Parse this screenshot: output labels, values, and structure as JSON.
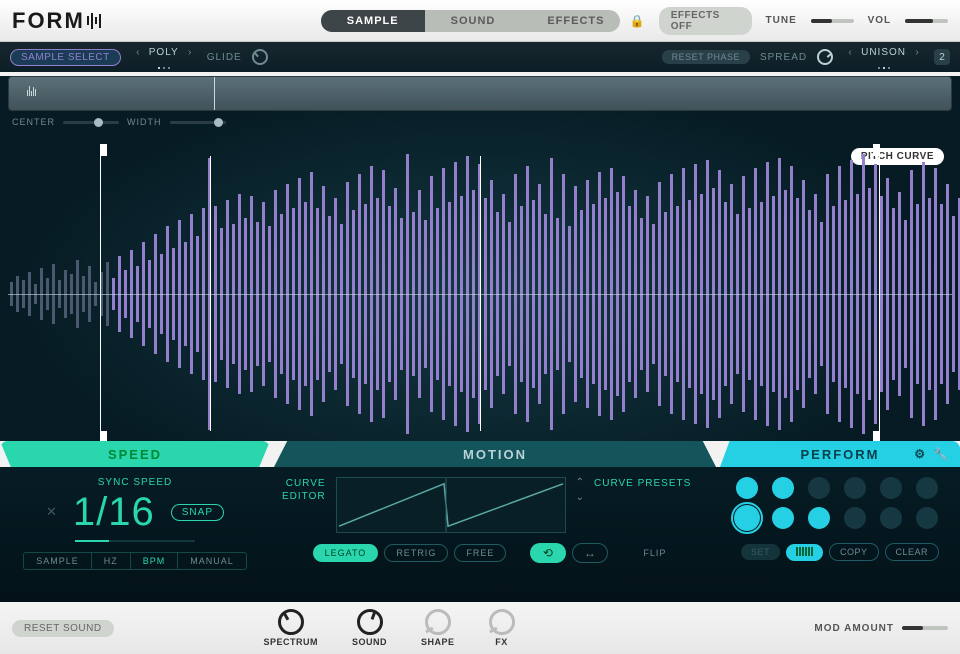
{
  "app": {
    "name": "FORM"
  },
  "top": {
    "tabs": [
      "SAMPLE",
      "SOUND",
      "EFFECTS"
    ],
    "active_tab": "SAMPLE",
    "effects_toggle": "EFFECTS OFF",
    "tune_label": "TUNE",
    "vol_label": "VOL"
  },
  "sub": {
    "sample_select": "SAMPLE SELECT",
    "voice_mode": "POLY",
    "glide": "GLIDE",
    "reset_phase": "RESET PHASE",
    "spread": "SPREAD",
    "unison": "UNISON",
    "unison_count": "2"
  },
  "wave": {
    "center": "CENTER",
    "width": "WIDTH",
    "pitch_curve": "PITCH CURVE"
  },
  "sections": {
    "speed": "SPEED",
    "motion": "MOTION",
    "perform": "PERFORM"
  },
  "speed": {
    "title": "SYNC SPEED",
    "value": "1/16",
    "snap": "SNAP",
    "modes": [
      "SAMPLE",
      "HZ",
      "BPM",
      "MANUAL"
    ],
    "active_mode": "BPM"
  },
  "motion": {
    "curve_editor": "CURVE\nEDITOR",
    "curve_presets": "CURVE\nPRESETS",
    "legato": "LEGATO",
    "retrig": "RETRIG",
    "free": "FREE",
    "flip": "FLIP"
  },
  "perform": {
    "set": "SET",
    "copy": "COPY",
    "clear": "CLEAR",
    "slots": [
      {
        "on": true
      },
      {
        "on": true
      },
      {
        "on": false
      },
      {
        "on": false
      },
      {
        "on": false
      },
      {
        "on": false
      },
      {
        "on": true,
        "sel": true
      },
      {
        "on": true
      },
      {
        "on": true
      },
      {
        "on": false
      },
      {
        "on": false
      },
      {
        "on": false
      }
    ]
  },
  "footer": {
    "reset_sound": "RESET SOUND",
    "macros": [
      "SPECTRUM",
      "SOUND",
      "SHAPE",
      "FX"
    ],
    "mod_amount": "MOD AMOUNT"
  },
  "waveform_heights": [
    12,
    18,
    14,
    22,
    10,
    26,
    16,
    30,
    14,
    24,
    20,
    34,
    18,
    28,
    12,
    22,
    32,
    16,
    38,
    24,
    44,
    28,
    52,
    34,
    60,
    40,
    68,
    46,
    74,
    52,
    80,
    58,
    86,
    136,
    88,
    66,
    94,
    70,
    100,
    76,
    98,
    72,
    92,
    68,
    104,
    80,
    110,
    86,
    116,
    92,
    122,
    86,
    108,
    78,
    96,
    70,
    112,
    84,
    120,
    90,
    128,
    96,
    124,
    88,
    106,
    76,
    140,
    82,
    104,
    74,
    118,
    86,
    126,
    92,
    132,
    98,
    138,
    104,
    130,
    96,
    114,
    82,
    100,
    72,
    120,
    88,
    128,
    94,
    110,
    80,
    136,
    76,
    120,
    68,
    108,
    84,
    114,
    90,
    122,
    96,
    126,
    102,
    118,
    88,
    104,
    76,
    98,
    70,
    112,
    82,
    120,
    88,
    126,
    94,
    130,
    100,
    134,
    106,
    124,
    92,
    110,
    80,
    118,
    86,
    126,
    92,
    132,
    98,
    136,
    104,
    128,
    96,
    114,
    84,
    100,
    72,
    120,
    88,
    128,
    94,
    134,
    100,
    140,
    106,
    130,
    98,
    116,
    86,
    102,
    74,
    124,
    90,
    132,
    96,
    126,
    90,
    110,
    78,
    96,
    66,
    80,
    54,
    68,
    44,
    56,
    36,
    44,
    28,
    36,
    22,
    28,
    16,
    20,
    12,
    14,
    8
  ]
}
